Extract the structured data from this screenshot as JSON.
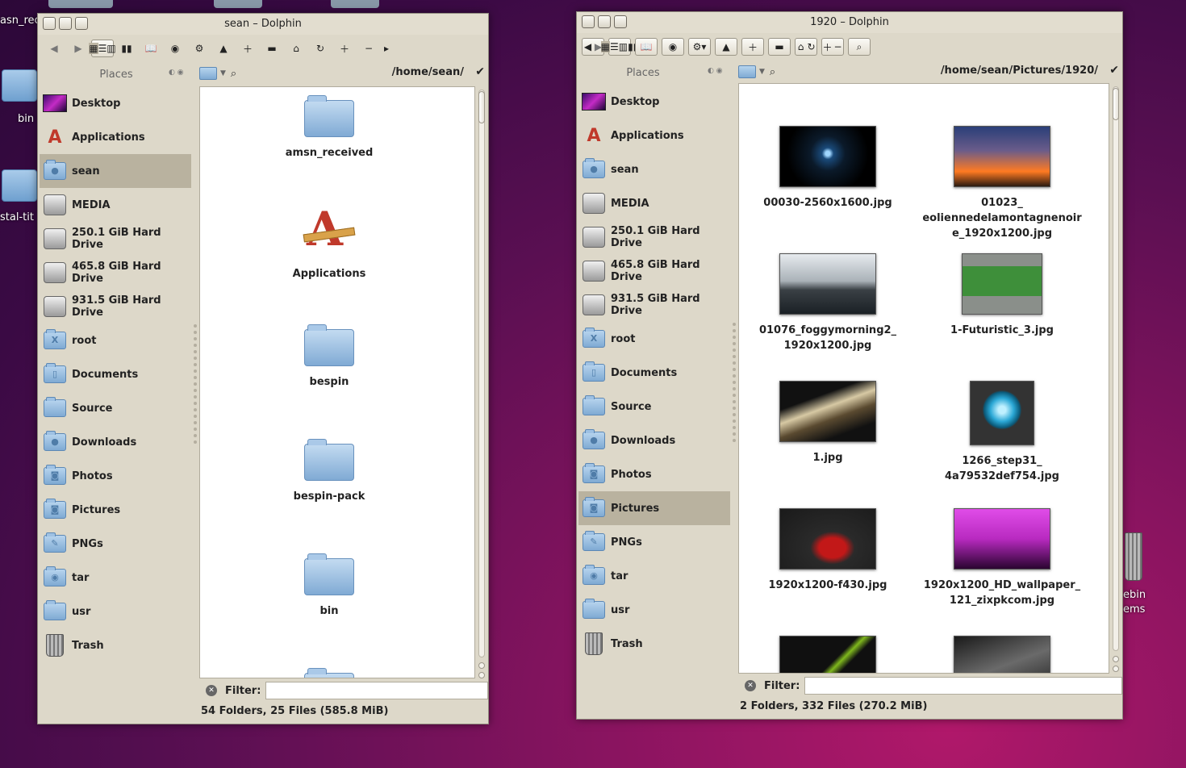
{
  "desktop": {
    "labels": [
      "asn_rec",
      "bin",
      "stal-tit",
      "ebin",
      "ems"
    ]
  },
  "left_window": {
    "title": "sean – Dolphin",
    "places_title": "Places",
    "places": [
      {
        "label": "Desktop",
        "icon": "desktop-icon"
      },
      {
        "label": "Applications",
        "icon": "applications-icon"
      },
      {
        "label": "sean",
        "icon": "home-folder-icon",
        "selected": true
      },
      {
        "label": "MEDIA",
        "icon": "drive-icon"
      },
      {
        "label": "250.1 GiB Hard Drive",
        "icon": "drive-icon"
      },
      {
        "label": "465.8 GiB Hard Drive",
        "icon": "drive-icon"
      },
      {
        "label": "931.5 GiB Hard Drive",
        "icon": "drive-icon"
      },
      {
        "label": "root",
        "icon": "root-folder-icon"
      },
      {
        "label": "Documents",
        "icon": "documents-folder-icon"
      },
      {
        "label": "Source",
        "icon": "folder-icon"
      },
      {
        "label": "Downloads",
        "icon": "downloads-folder-icon"
      },
      {
        "label": "Photos",
        "icon": "photos-folder-icon"
      },
      {
        "label": "Pictures",
        "icon": "pictures-folder-icon"
      },
      {
        "label": "PNGs",
        "icon": "pngs-folder-icon"
      },
      {
        "label": "tar",
        "icon": "tar-folder-icon"
      },
      {
        "label": "usr",
        "icon": "folder-icon"
      },
      {
        "label": "Trash",
        "icon": "trash-icon"
      }
    ],
    "path": "/home/sean/",
    "items": [
      {
        "label": "amsn_received",
        "type": "folder"
      },
      {
        "label": "Applications",
        "type": "app"
      },
      {
        "label": "bespin",
        "type": "folder"
      },
      {
        "label": "bespin-pack",
        "type": "folder"
      },
      {
        "label": "bin",
        "type": "folder"
      }
    ],
    "filter_label": "Filter:",
    "filter_value": "",
    "status": "54 Folders, 25 Files (585.8 MiB)"
  },
  "right_window": {
    "title": "1920 – Dolphin",
    "places_title": "Places",
    "places": [
      {
        "label": "Desktop",
        "icon": "desktop-icon"
      },
      {
        "label": "Applications",
        "icon": "applications-icon"
      },
      {
        "label": "sean",
        "icon": "home-folder-icon"
      },
      {
        "label": "MEDIA",
        "icon": "drive-icon"
      },
      {
        "label": "250.1 GiB Hard Drive",
        "icon": "drive-icon"
      },
      {
        "label": "465.8 GiB Hard Drive",
        "icon": "drive-icon"
      },
      {
        "label": "931.5 GiB Hard Drive",
        "icon": "drive-icon"
      },
      {
        "label": "root",
        "icon": "root-folder-icon"
      },
      {
        "label": "Documents",
        "icon": "documents-folder-icon"
      },
      {
        "label": "Source",
        "icon": "folder-icon"
      },
      {
        "label": "Downloads",
        "icon": "downloads-folder-icon"
      },
      {
        "label": "Photos",
        "icon": "photos-folder-icon"
      },
      {
        "label": "Pictures",
        "icon": "pictures-folder-icon",
        "selected": true
      },
      {
        "label": "PNGs",
        "icon": "pngs-folder-icon"
      },
      {
        "label": "tar",
        "icon": "tar-folder-icon"
      },
      {
        "label": "usr",
        "icon": "folder-icon"
      },
      {
        "label": "Trash",
        "icon": "trash-icon"
      }
    ],
    "path": "/home/sean/Pictures/1920/",
    "thumbs": [
      {
        "label1": "00030-2560x1600.jpg",
        "label2": "",
        "label3": "",
        "colors": [
          "#000000",
          "#0b1a2a"
        ]
      },
      {
        "label1": "01023_",
        "label2": "eoliennedelamontagnenoir",
        "label3": "e_1920x1200.jpg",
        "colors": [
          "#2a3e78",
          "#ff7a22"
        ]
      },
      {
        "label1": "01076_foggymorning2_",
        "label2": "1920x1200.jpg",
        "label3": "",
        "colors": [
          "#e6eaee",
          "#1a2025"
        ]
      },
      {
        "label1": "1-Futuristic_3.jpg",
        "label2": "",
        "label3": "",
        "colors": [
          "#8a8f8a",
          "#3e8f3a"
        ]
      },
      {
        "label1": "1.jpg",
        "label2": "",
        "label3": "",
        "colors": [
          "#d7c9a4",
          "#111111"
        ]
      },
      {
        "label1": "1266_step31_",
        "label2": "4a79532def754.jpg",
        "label3": "",
        "colors": [
          "#2ba8d6",
          "#333333"
        ]
      },
      {
        "label1": "1920x1200-f430.jpg",
        "label2": "",
        "label3": "",
        "colors": [
          "#2a2a2a",
          "#c21818"
        ]
      },
      {
        "label1": "1920x1200_HD_wallpaper_",
        "label2": "121_zixpkcom.jpg",
        "label3": "",
        "colors": [
          "#e04ce8",
          "#2a0530"
        ]
      },
      {
        "label1": "",
        "label2": "",
        "label3": "",
        "colors": [
          "#101010",
          "#7fb81d"
        ]
      },
      {
        "label1": "",
        "label2": "",
        "label3": "",
        "colors": [
          "#6a6a6a",
          "#1a1a1a"
        ]
      }
    ],
    "filter_label": "Filter:",
    "filter_value": "",
    "status": "2 Folders, 332 Files (270.2 MiB)"
  }
}
